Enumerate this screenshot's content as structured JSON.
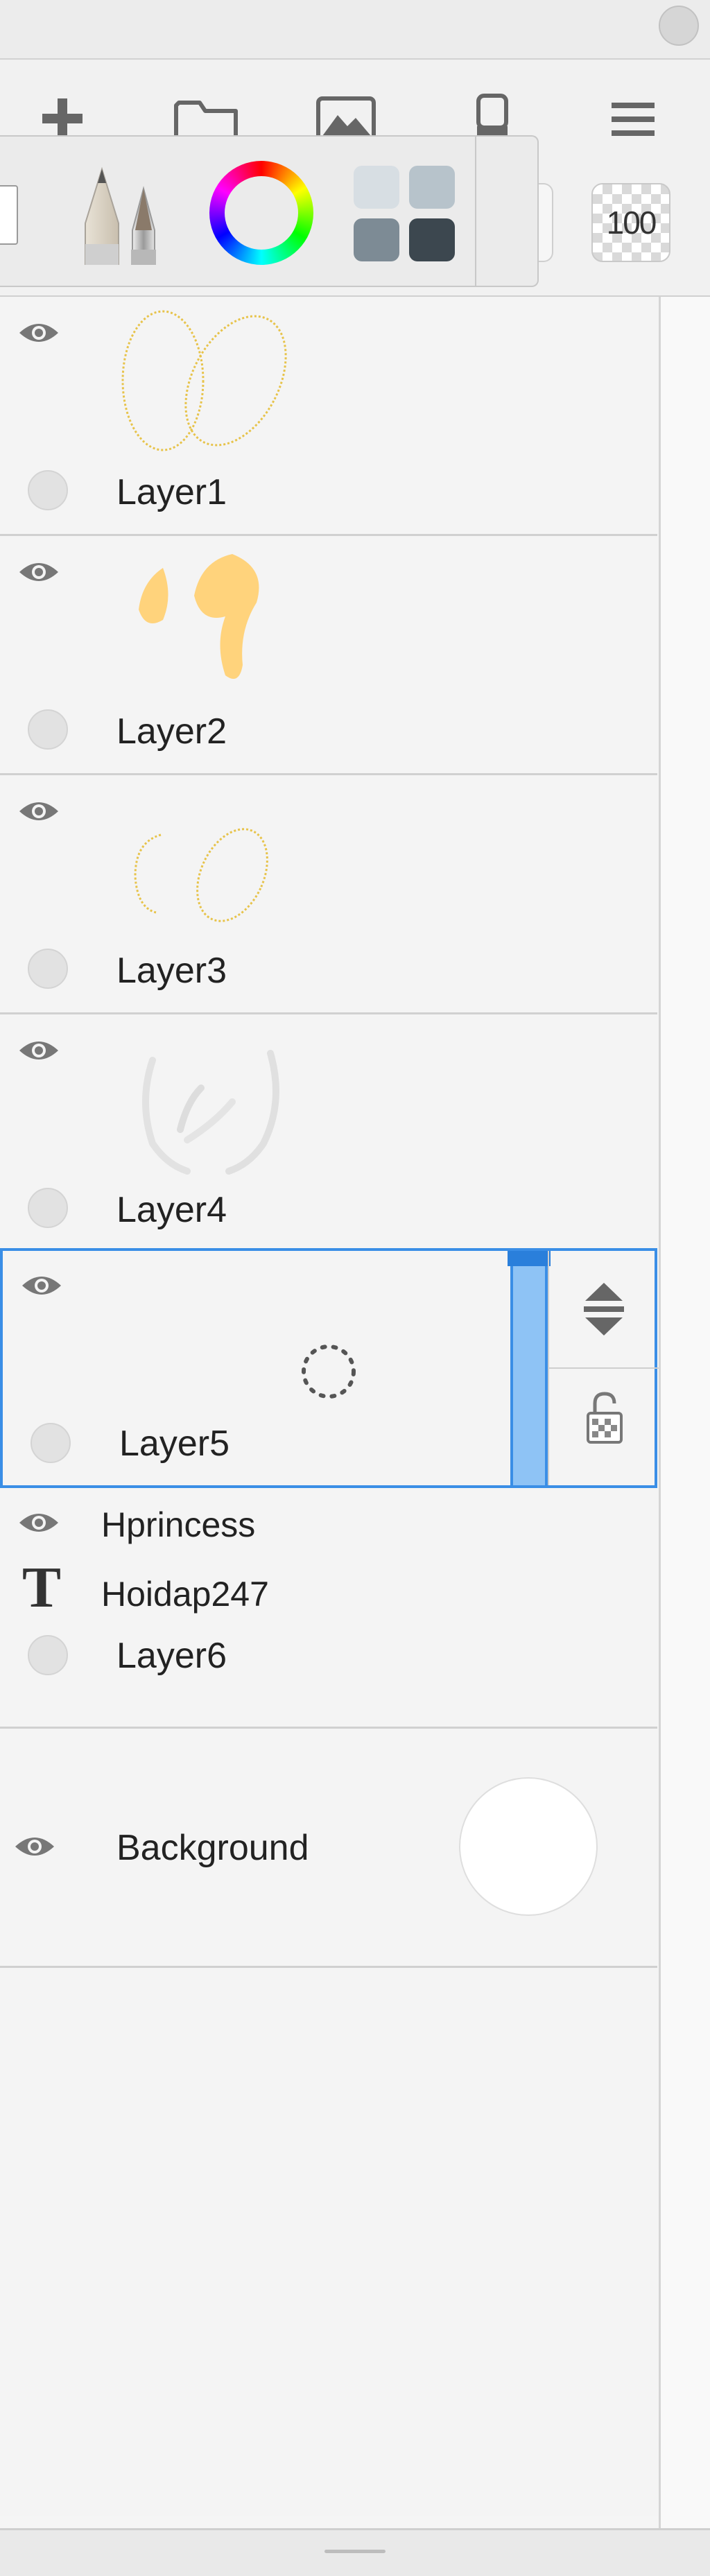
{
  "toolbar": {
    "opacity_value": "100",
    "icons": [
      "plus-icon",
      "folder-icon",
      "image-icon",
      "eraser-icon",
      "menu-icon"
    ],
    "brush_panel_icons": [
      "brush-preview-icon",
      "pencil-icon",
      "color-wheel-icon",
      "swatches-icon"
    ]
  },
  "layers": [
    {
      "name": "Layer1",
      "visible": true,
      "thumbnail": "yellow-ovals-outline"
    },
    {
      "name": "Layer2",
      "visible": true,
      "thumbnail": "yellow-filled-shapes"
    },
    {
      "name": "Layer3",
      "visible": true,
      "thumbnail": "yellow-ovals-outline"
    },
    {
      "name": "Layer4",
      "visible": true,
      "thumbnail": "faint-gray-strokes"
    },
    {
      "name": "Layer5",
      "visible": true,
      "selected": true,
      "thumbnail": "empty-loading"
    },
    {
      "name": "Layer6",
      "visible": true,
      "text_lines": [
        "Hprincess",
        "Hoidap247"
      ]
    },
    {
      "name": "Background",
      "visible": true,
      "color": "#ffffff"
    }
  ],
  "colors": {
    "selection_accent": "#3a8ee6",
    "handle_fill": "#8ec3f5",
    "stroke_yellow": "#e7c34a",
    "fill_yellow": "#ffd37c"
  }
}
